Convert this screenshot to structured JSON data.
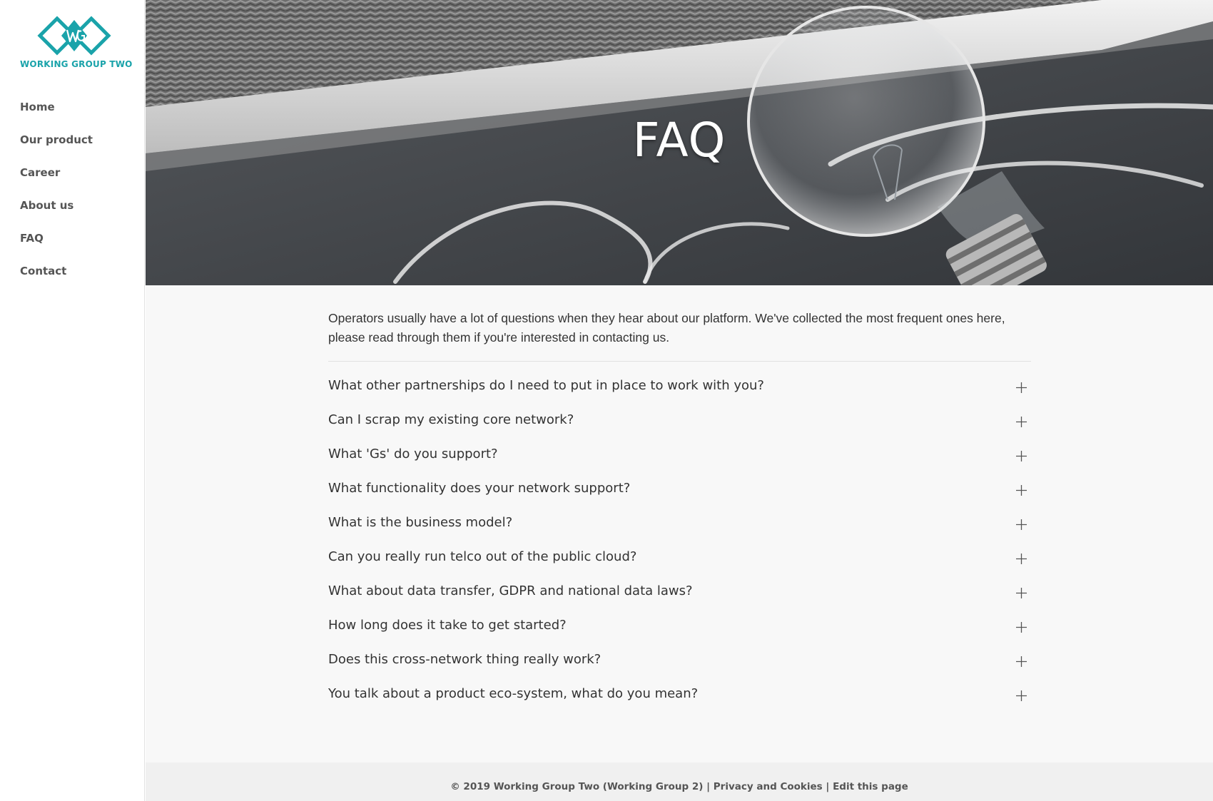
{
  "brand": {
    "name": "WORKING GROUP TWO",
    "accent_color": "#1aa3aa",
    "logo_icon": "wg-diamond-logo"
  },
  "sidebar": {
    "items": [
      {
        "label": "Home"
      },
      {
        "label": "Our product"
      },
      {
        "label": "Career"
      },
      {
        "label": "About us"
      },
      {
        "label": "FAQ"
      },
      {
        "label": "Contact"
      }
    ]
  },
  "hero": {
    "title": "FAQ",
    "image": "lightbulb-on-chalkboard"
  },
  "main": {
    "intro": "Operators usually have a lot of questions when they hear about our platform. We've collected the most frequent ones here, please read through them if you're interested in contacting us.",
    "faq": [
      {
        "question": "What other partnerships do I need to put in place to work with you?",
        "icon": "plus-icon"
      },
      {
        "question": "Can I scrap my existing core network?",
        "icon": "plus-icon"
      },
      {
        "question": "What 'Gs' do you support?",
        "icon": "plus-icon"
      },
      {
        "question": "What functionality does your network support?",
        "icon": "plus-icon"
      },
      {
        "question": "What is the business model?",
        "icon": "plus-icon"
      },
      {
        "question": "Can you really run telco out of the public cloud?",
        "icon": "plus-icon"
      },
      {
        "question": "What about data transfer, GDPR and national data laws?",
        "icon": "plus-icon"
      },
      {
        "question": "How long does it take to get started?",
        "icon": "plus-icon"
      },
      {
        "question": "Does this cross-network thing really work?",
        "icon": "plus-icon"
      },
      {
        "question": "You talk about a product eco-system, what do you mean?",
        "icon": "plus-icon"
      }
    ]
  },
  "footer": {
    "copyright": "© 2019 Working Group Two (Working Group 2)",
    "separator": "|",
    "privacy_label": "Privacy and Cookies",
    "edit_label": "Edit this page"
  }
}
